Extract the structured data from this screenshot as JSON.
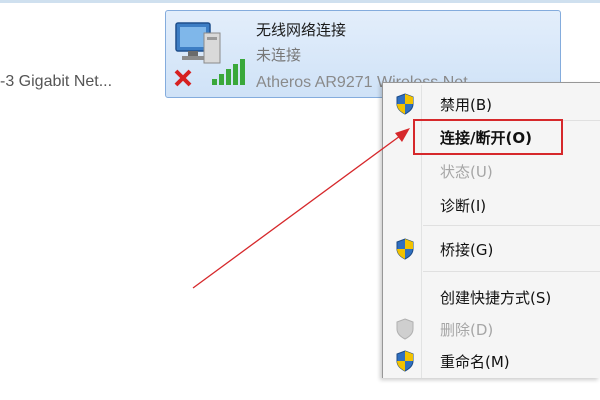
{
  "network": {
    "wired_label": "-3 Gigabit Net...",
    "wireless": {
      "name": "无线网络连接",
      "status": "未连接",
      "adapter": "Atheros AR9271 Wireless Net..."
    }
  },
  "context_menu": {
    "items": [
      {
        "label": "禁用(B)",
        "icon": "uac-shield-icon",
        "disabled": false,
        "bold": false
      },
      {
        "label": "连接/断开(O)",
        "icon": "",
        "disabled": false,
        "bold": true
      },
      {
        "label": "状态(U)",
        "icon": "",
        "disabled": true,
        "bold": false
      },
      {
        "label": "诊断(I)",
        "icon": "",
        "disabled": false,
        "bold": false
      },
      {
        "label": "桥接(G)",
        "icon": "uac-shield-icon",
        "disabled": false,
        "bold": false
      },
      {
        "label": "创建快捷方式(S)",
        "icon": "",
        "disabled": false,
        "bold": false
      },
      {
        "label": "删除(D)",
        "icon": "uac-shield-icon",
        "disabled": true,
        "bold": false
      },
      {
        "label": "重命名(M)",
        "icon": "uac-shield-icon",
        "disabled": false,
        "bold": false
      }
    ]
  },
  "colors": {
    "highlight_box": "#d6282b",
    "annotation_arrow": "#d6282b",
    "tile_border": "#84acdd"
  }
}
